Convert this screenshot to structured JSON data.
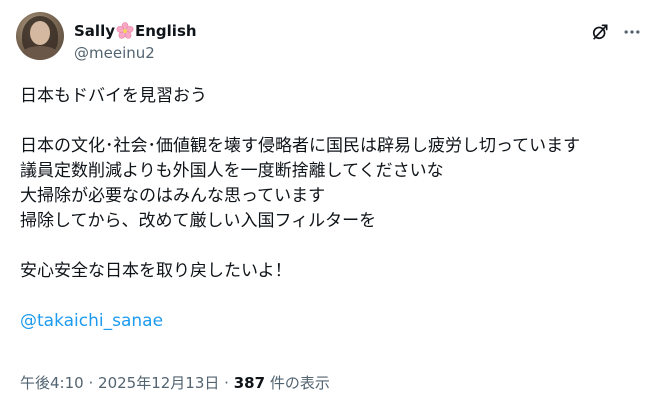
{
  "author": {
    "display_name_part1": "Sally",
    "display_name_part2": "English",
    "name_emoji": "cherry-blossom-icon",
    "handle": "@meeinu2"
  },
  "tweet": {
    "lines_block1": [
      "日本もドバイを見習おう"
    ],
    "lines_block2": [
      "日本の文化･社会･価値観を壊す侵略者に国民は辟易し疲労し切っています",
      "議員定数削減よりも外国人を一度断捨離してくださいな",
      "大掃除が必要なのはみんな思っています",
      "掃除してから、改めて厳しい入国フィルターを"
    ],
    "lines_block3": [
      "安心安全な日本を取り戻したいよ！"
    ],
    "mention": "@takaichi_sanae"
  },
  "meta": {
    "time": "午後4:10",
    "separator": "·",
    "date": "2025年12月13日",
    "views_count": "387",
    "views_label": "件の表示"
  },
  "icons": {
    "grok": "grok-icon",
    "more": "more-icon"
  },
  "colors": {
    "text": "#0f1419",
    "secondary": "#536471",
    "link": "#1d9bf0"
  }
}
